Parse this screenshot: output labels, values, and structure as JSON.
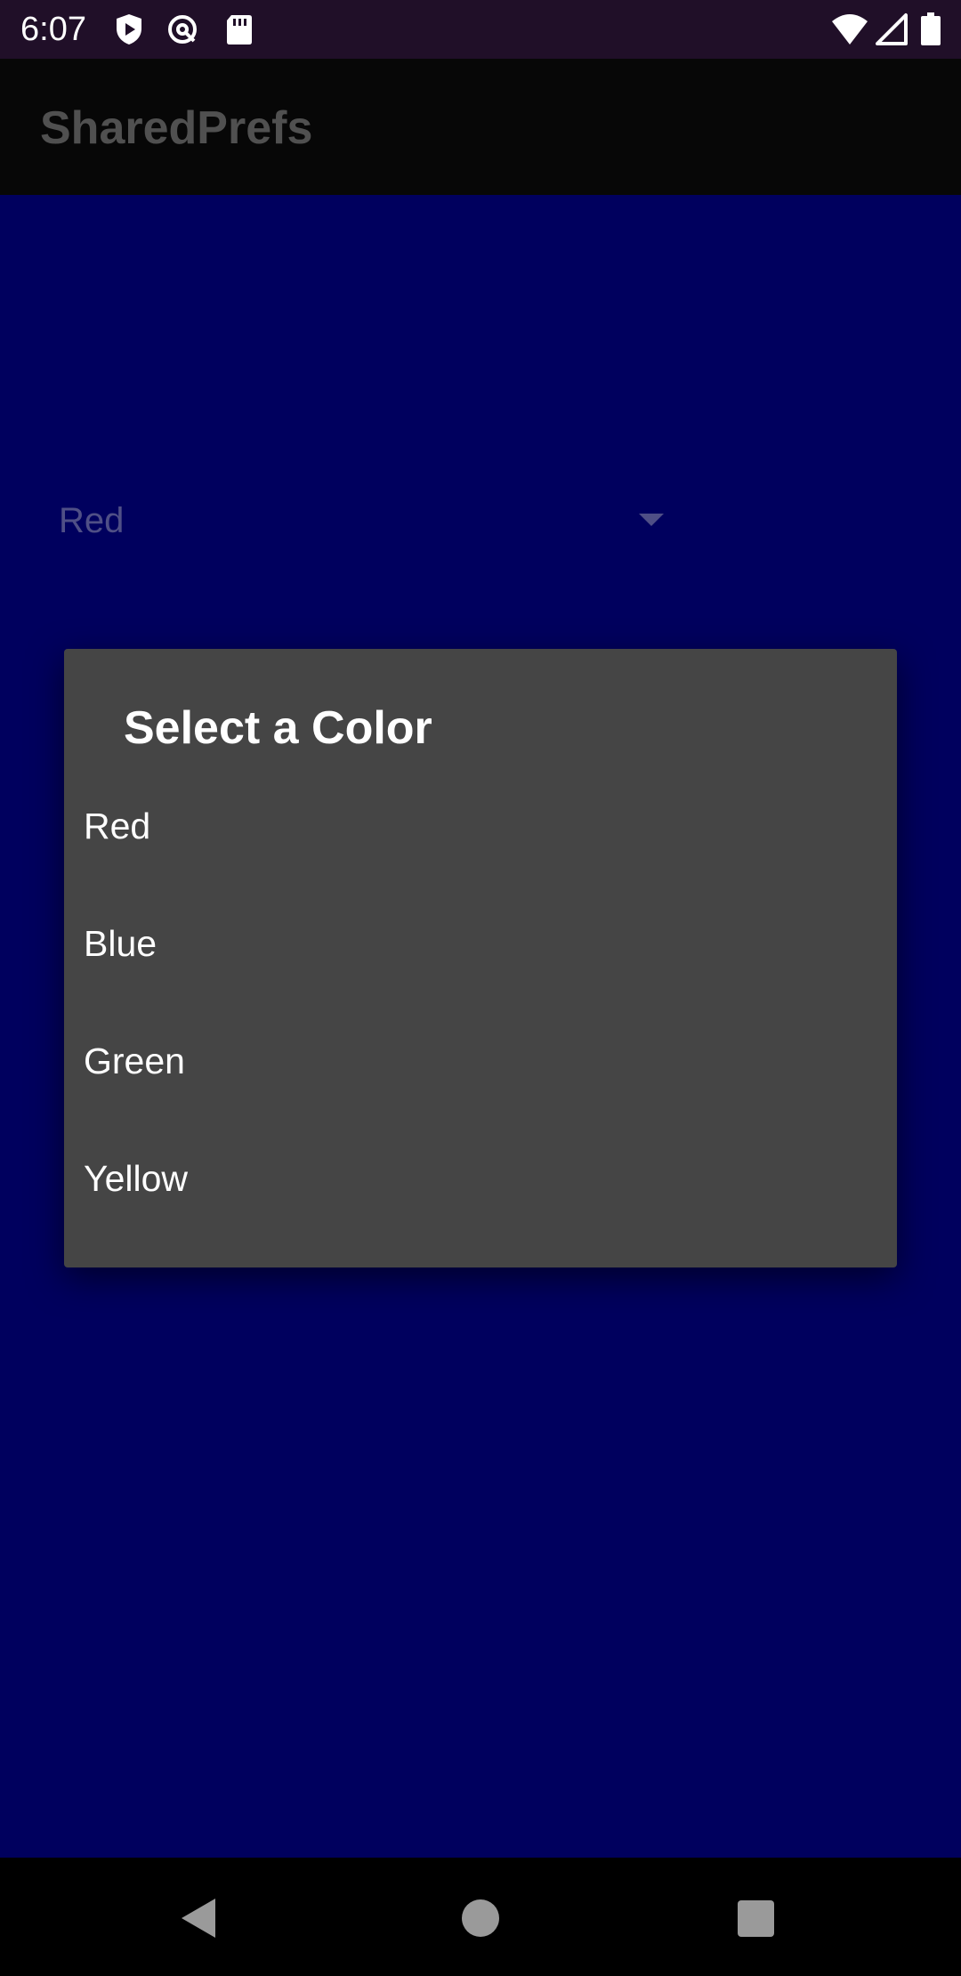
{
  "status_bar": {
    "time": "6:07",
    "left_icons": [
      "play-protect-icon",
      "data-saver-icon",
      "sd-card-icon"
    ],
    "right_icons": [
      "wifi-icon",
      "cell-signal-icon",
      "battery-icon"
    ]
  },
  "app_bar": {
    "title": "SharedPrefs"
  },
  "main": {
    "background_color": "#00005e",
    "spinner": {
      "selected_value": "Red"
    }
  },
  "dialog": {
    "title": "Select a Color",
    "items": [
      {
        "label": "Red"
      },
      {
        "label": "Blue"
      },
      {
        "label": "Green"
      },
      {
        "label": "Yellow"
      }
    ]
  },
  "nav_bar": {
    "buttons": [
      "back-icon",
      "home-icon",
      "recents-icon"
    ]
  }
}
